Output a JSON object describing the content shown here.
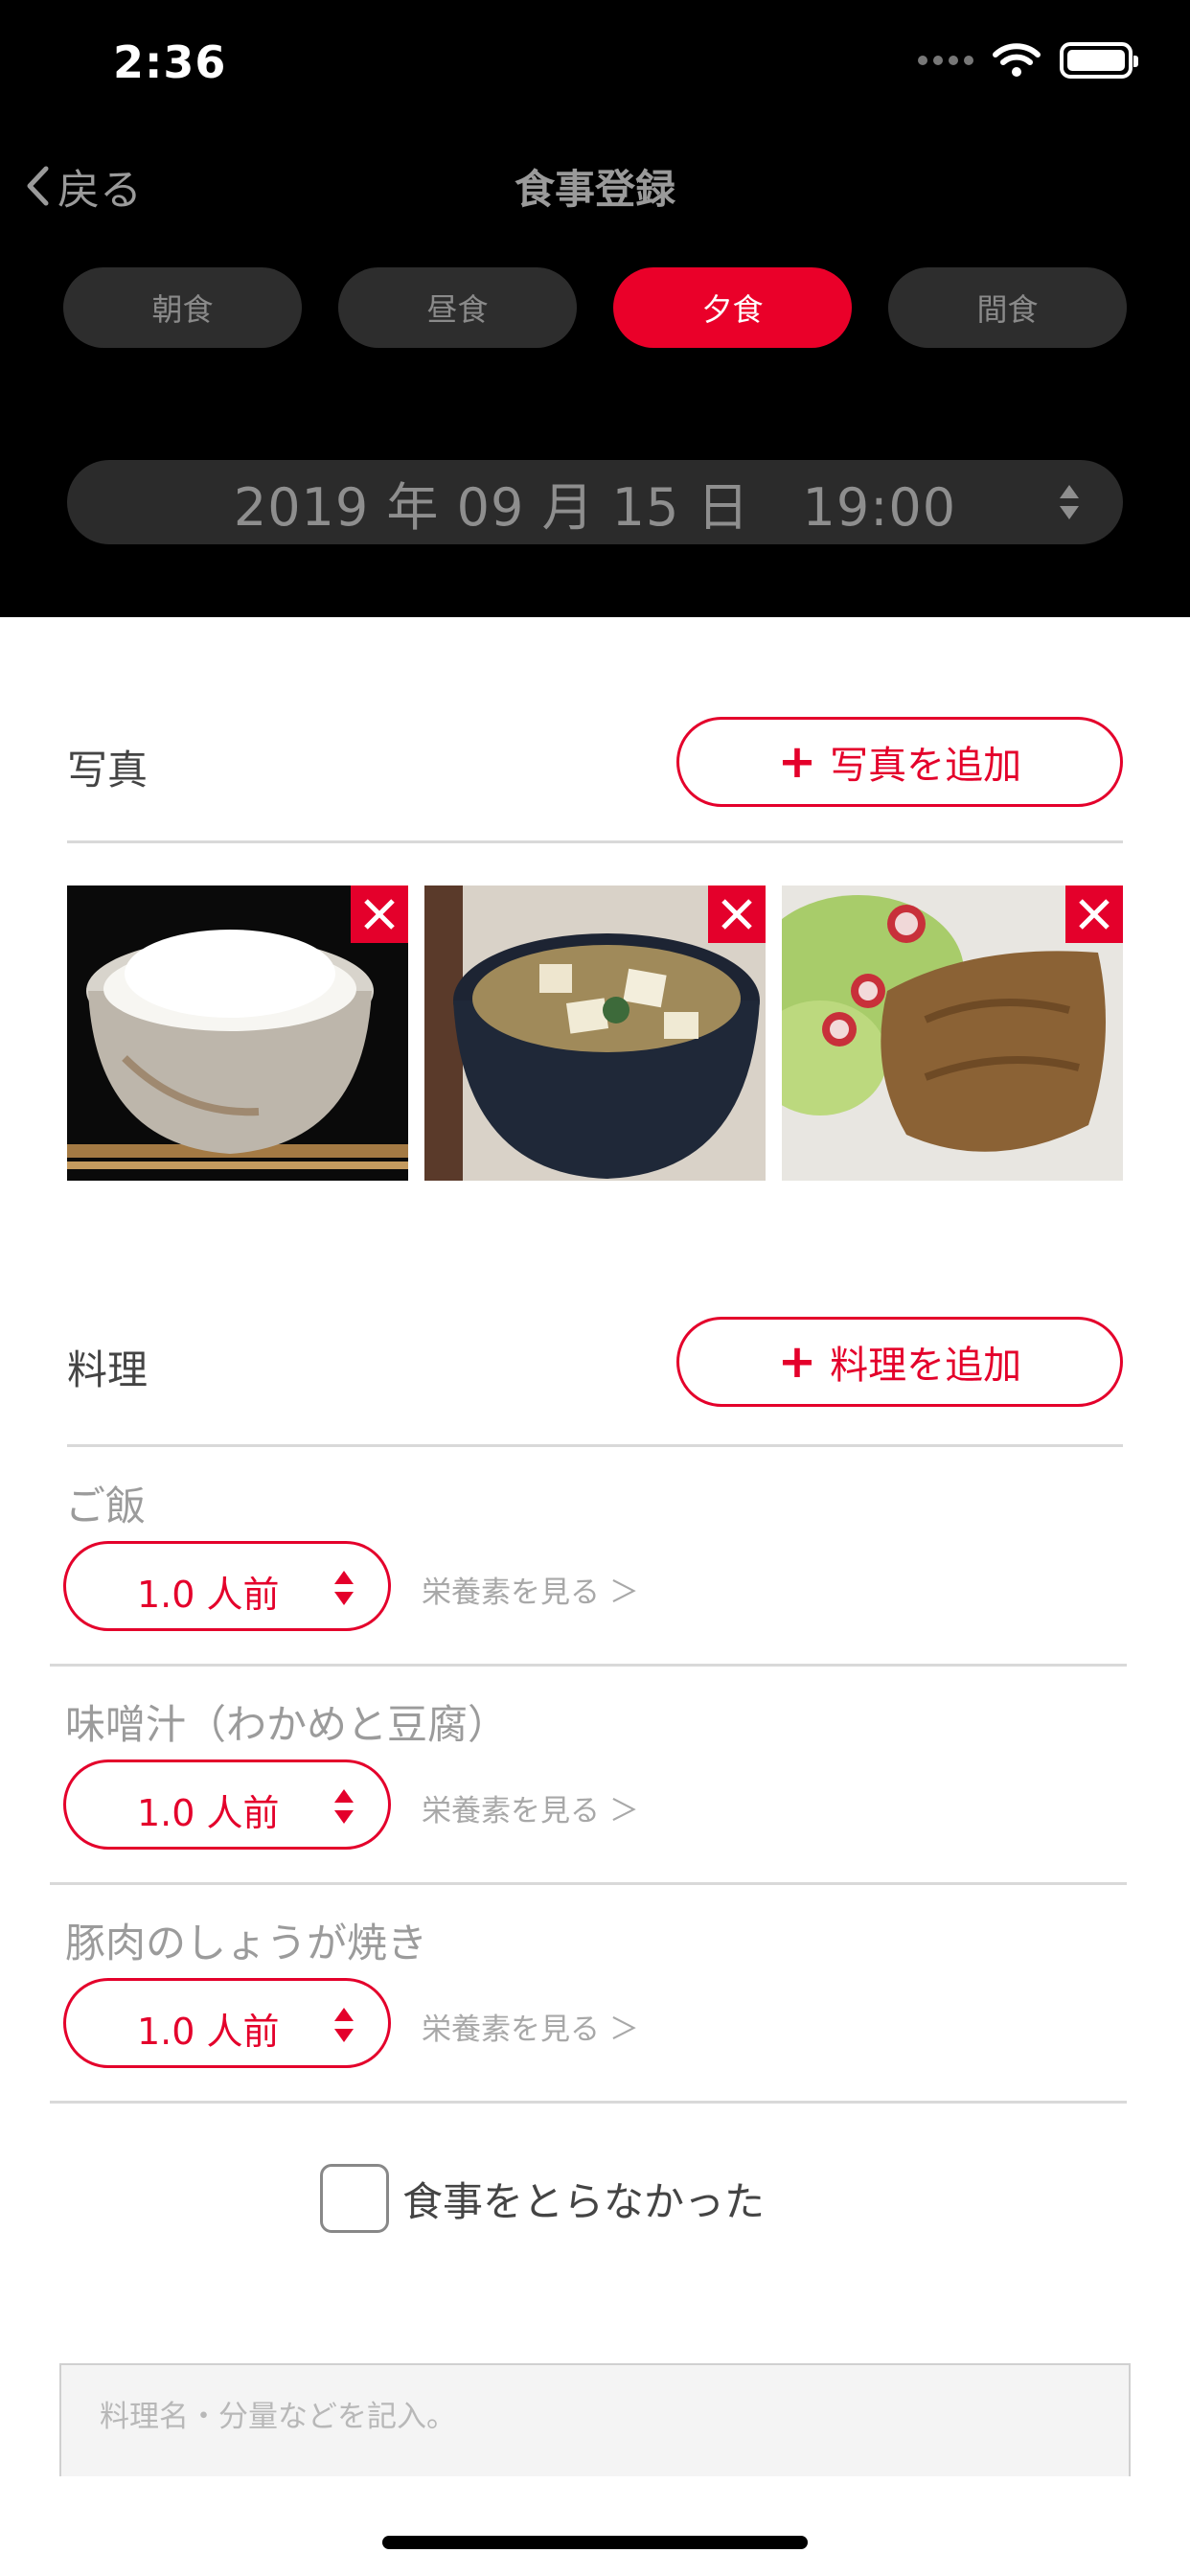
{
  "status_bar": {
    "time": "2:36"
  },
  "nav": {
    "back_label": "戻る",
    "title": "食事登録"
  },
  "meal_tabs": [
    {
      "label": "朝食",
      "active": false
    },
    {
      "label": "昼食",
      "active": false
    },
    {
      "label": "夕食",
      "active": true
    },
    {
      "label": "間食",
      "active": false
    }
  ],
  "datetime": {
    "text": "2019 年 09 月 15 日　19:00"
  },
  "photos": {
    "label": "写真",
    "add_label": "写真を追加",
    "items": [
      {
        "name": "rice-bowl-photo"
      },
      {
        "name": "miso-soup-photo"
      },
      {
        "name": "ginger-pork-photo"
      }
    ]
  },
  "dishes": {
    "label": "料理",
    "add_label": "料理を追加",
    "items": [
      {
        "name": "ご飯",
        "quantity": "1.0 人前",
        "nutrition_link": "栄養素を見る ＞"
      },
      {
        "name": "味噌汁（わかめと豆腐）",
        "quantity": "1.0 人前",
        "nutrition_link": "栄養素を見る ＞"
      },
      {
        "name": "豚肉のしょうが焼き",
        "quantity": "1.0 人前",
        "nutrition_link": "栄養素を見る ＞"
      }
    ]
  },
  "skip_meal": {
    "label": "食事をとらなかった",
    "checked": false
  },
  "memo": {
    "placeholder": "料理名・分量などを記入。"
  },
  "colors": {
    "accent": "#e4002b",
    "header_bg": "#000000",
    "pill_bg": "#2d2d2d"
  }
}
